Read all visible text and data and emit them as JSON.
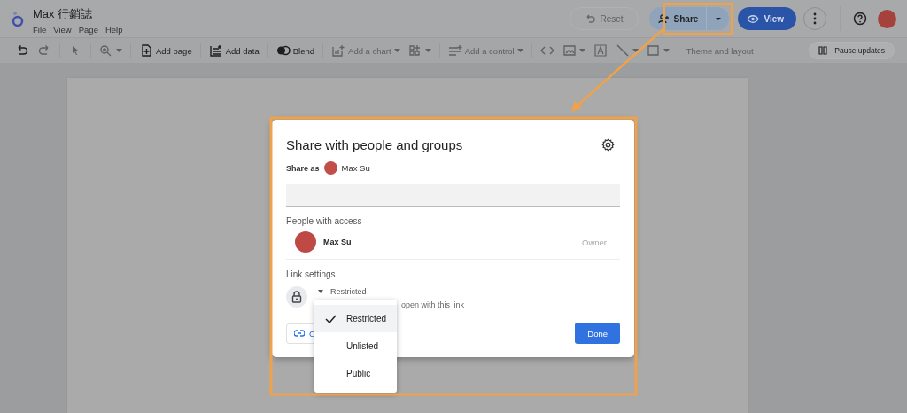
{
  "app": {
    "title": "Max 行銷誌",
    "menu": [
      "File",
      "View",
      "Page",
      "Help"
    ]
  },
  "header_buttons": {
    "reset": "Reset",
    "share": "Share",
    "view": "View"
  },
  "toolbar": [
    {
      "kind": "undo",
      "disabled": false
    },
    {
      "kind": "redo",
      "disabled": true
    },
    {
      "kind": "select",
      "disabled": true
    },
    {
      "kind": "zoom",
      "disabled": true
    },
    {
      "kind": "add-page",
      "label": "Add page",
      "disabled": false
    },
    {
      "kind": "add-data",
      "label": "Add data",
      "disabled": false
    },
    {
      "kind": "blend",
      "label": "Blend",
      "disabled": false
    },
    {
      "kind": "add-chart",
      "label": "Add a chart",
      "disabled": true
    },
    {
      "kind": "community",
      "disabled": true
    },
    {
      "kind": "add-control",
      "label": "Add a control",
      "disabled": true
    },
    {
      "kind": "code",
      "disabled": true
    },
    {
      "kind": "image",
      "disabled": true
    },
    {
      "kind": "text",
      "disabled": true
    },
    {
      "kind": "line",
      "disabled": true
    },
    {
      "kind": "shape",
      "disabled": true
    },
    {
      "kind": "theme",
      "label": "Theme and layout",
      "disabled": true
    }
  ],
  "pause_button": "Pause updates",
  "dialog": {
    "title": "Share with people and groups",
    "share_as_label": "Share as",
    "share_as_user": "Max Su",
    "people_heading": "People with access",
    "people": [
      {
        "name": "Max Su",
        "role": "Owner"
      }
    ],
    "link_heading": "Link settings",
    "access": "Restricted",
    "access_description": "open with this link",
    "copy_button": "C",
    "done_button": "Done"
  },
  "access_menu": [
    {
      "label": "Restricted",
      "selected": true
    },
    {
      "label": "Unlisted",
      "selected": false
    },
    {
      "label": "Public",
      "selected": false
    }
  ]
}
